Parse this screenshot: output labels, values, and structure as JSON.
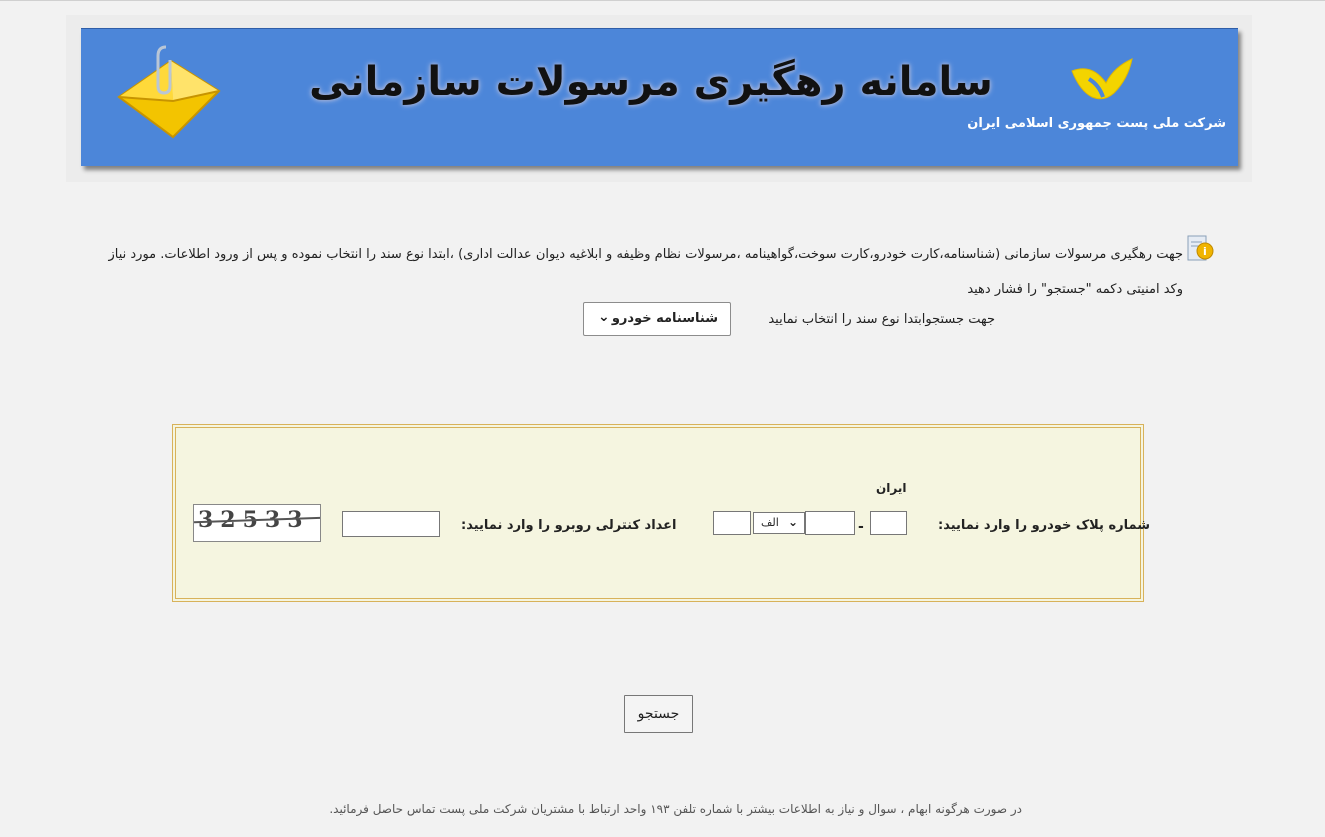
{
  "banner": {
    "title": "سامانه رهگیری مرسولات سازمانی",
    "company": "شرکت ملی پست جمهوری اسلامی ایران"
  },
  "intro": {
    "text": "جهت رهگیری مرسولات سازمانی (شناسنامه،کارت خودرو،کارت سوخت،گواهینامه ،مرسولات نظام وظیفه  و ابلاغیه دیوان عدالت اداری) ،ابتدا  نوع سند را انتخاب نموده و پس از ورود اطلاعات. مورد نیاز وکد امنیتی دکمه \"جستجو\" را فشار دهید"
  },
  "doc_type": {
    "label": "جهت جستجوابتدا نوع سند را انتخاب نمایید",
    "selected": "شناسنامه خودرو"
  },
  "form": {
    "plate_label": "شماره پلاک خودرو را وارد نمایید:",
    "iran_label": "ایران",
    "plate_letter": "الف",
    "captcha_label": "اعداد کنترلی روبرو را وارد نمایید:",
    "captcha_code": "32533"
  },
  "search_button": "جستجو",
  "footer": "در صورت هرگونه ابهام ، سوال و نیاز به اطلاعات بیشتر با شماره تلفن ۱۹۳ واحد ارتباط با مشتریان شرکت ملی پست تماس حاصل فرمائید.",
  "colors": {
    "banner": "#4c86d9",
    "form_bg": "#f5f5e0",
    "form_border": "#d8b25a"
  }
}
